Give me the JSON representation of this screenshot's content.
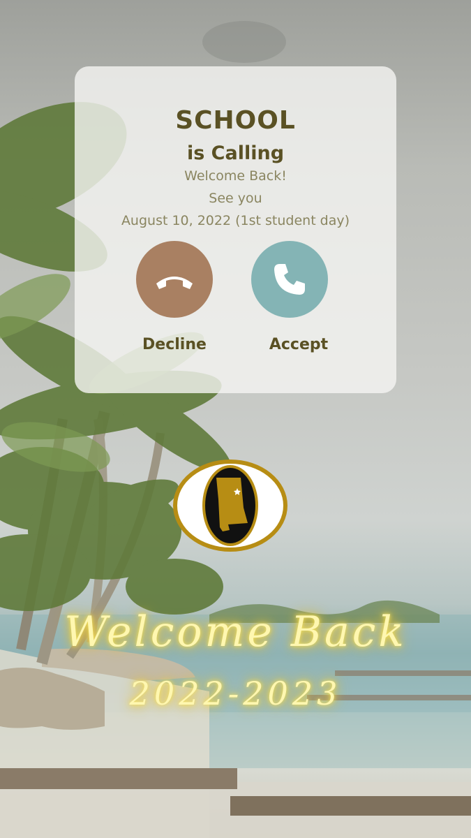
{
  "call": {
    "caller": "SCHOOL",
    "status": "is Calling",
    "line1": "Welcome Back!",
    "line2": "See you",
    "line3": "August 10, 2022 (1st student day)"
  },
  "actions": {
    "decline_label": "Decline",
    "accept_label": "Accept",
    "decline_icon": "phone-hangup-icon",
    "accept_icon": "phone-icon"
  },
  "banner": {
    "headline": "Welcome Back",
    "year": "2022-2023"
  },
  "colors": {
    "text_dark": "#5a5124",
    "text_muted": "#8a8560",
    "decline": "#a98062",
    "accept": "#84b4b5",
    "logo_gold": "#b78d14",
    "neon": "#fff7b0"
  }
}
